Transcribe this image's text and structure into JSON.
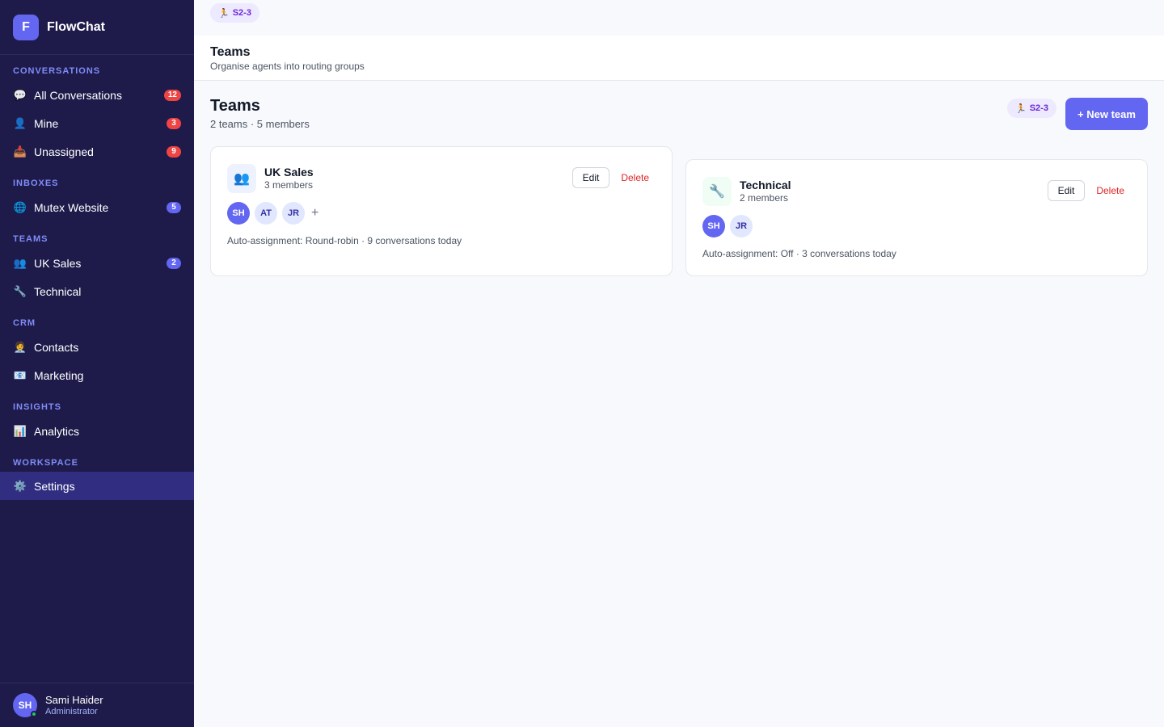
{
  "brand": {
    "logo_letter": "F",
    "name": "FlowChat"
  },
  "sidebar": {
    "sections": [
      {
        "label": "CONVERSATIONS"
      },
      {
        "label": "INBOXES"
      },
      {
        "label": "TEAMS"
      },
      {
        "label": "CRM"
      },
      {
        "label": "INSIGHTS"
      },
      {
        "label": "WORKSPACE"
      }
    ],
    "items": [
      {
        "icon": "💬",
        "icon_name": "chat-bubble-icon",
        "label": "All Conversations",
        "badge": "12"
      },
      {
        "icon": "👤",
        "icon_name": "person-icon",
        "label": "Mine",
        "badge": "3"
      },
      {
        "icon": "📥",
        "icon_name": "inbox-tray-icon",
        "label": "Unassigned",
        "badge": "9"
      },
      {
        "icon": "🌐",
        "icon_name": "globe-icon",
        "label": "Mutex Website",
        "badge": "5"
      },
      {
        "icon": "👥",
        "icon_name": "people-icon",
        "label": "UK Sales",
        "badge": "2"
      },
      {
        "icon": "🔧",
        "icon_name": "wrench-icon",
        "label": "Technical"
      },
      {
        "icon": "🧑‍💼",
        "icon_name": "contacts-icon",
        "label": "Contacts"
      },
      {
        "icon": "📧",
        "icon_name": "mail-icon",
        "label": "Marketing"
      },
      {
        "icon": "📊",
        "icon_name": "bar-chart-icon",
        "label": "Analytics"
      },
      {
        "icon": "⚙️",
        "icon_name": "gear-icon",
        "label": "Settings",
        "active": true
      }
    ]
  },
  "user": {
    "initials": "SH",
    "name": "Sami Haider",
    "role": "Administrator"
  },
  "sprint_tag": {
    "icon": "🏃",
    "label": "S2-3"
  },
  "header": {
    "title": "Teams",
    "subtitle": "Organise agents into routing groups"
  },
  "content": {
    "title": "Teams",
    "summary": "2 teams · 5 members",
    "new_team_label": "+ New team"
  },
  "teams": [
    {
      "icon": "👥",
      "icon_name": "people-icon",
      "name": "UK Sales",
      "count": "3 members",
      "members": [
        "SH",
        "AT",
        "JR"
      ],
      "add_label": "+",
      "auto": "Auto-assignment: Round-robin · 9 conversations today",
      "edit_label": "Edit",
      "delete_label": "Delete"
    },
    {
      "icon": "🔧",
      "icon_name": "wrench-icon",
      "name": "Technical",
      "count": "2 members",
      "members": [
        "SH",
        "JR"
      ],
      "auto": "Auto-assignment: Off · 3 conversations today",
      "edit_label": "Edit",
      "delete_label": "Delete"
    }
  ],
  "colors": {
    "sidebar_bg": "#1e1b4b",
    "accent": "#6366f1",
    "badge_red": "#ef4444",
    "danger": "#dc2626",
    "online": "#22c55e"
  }
}
